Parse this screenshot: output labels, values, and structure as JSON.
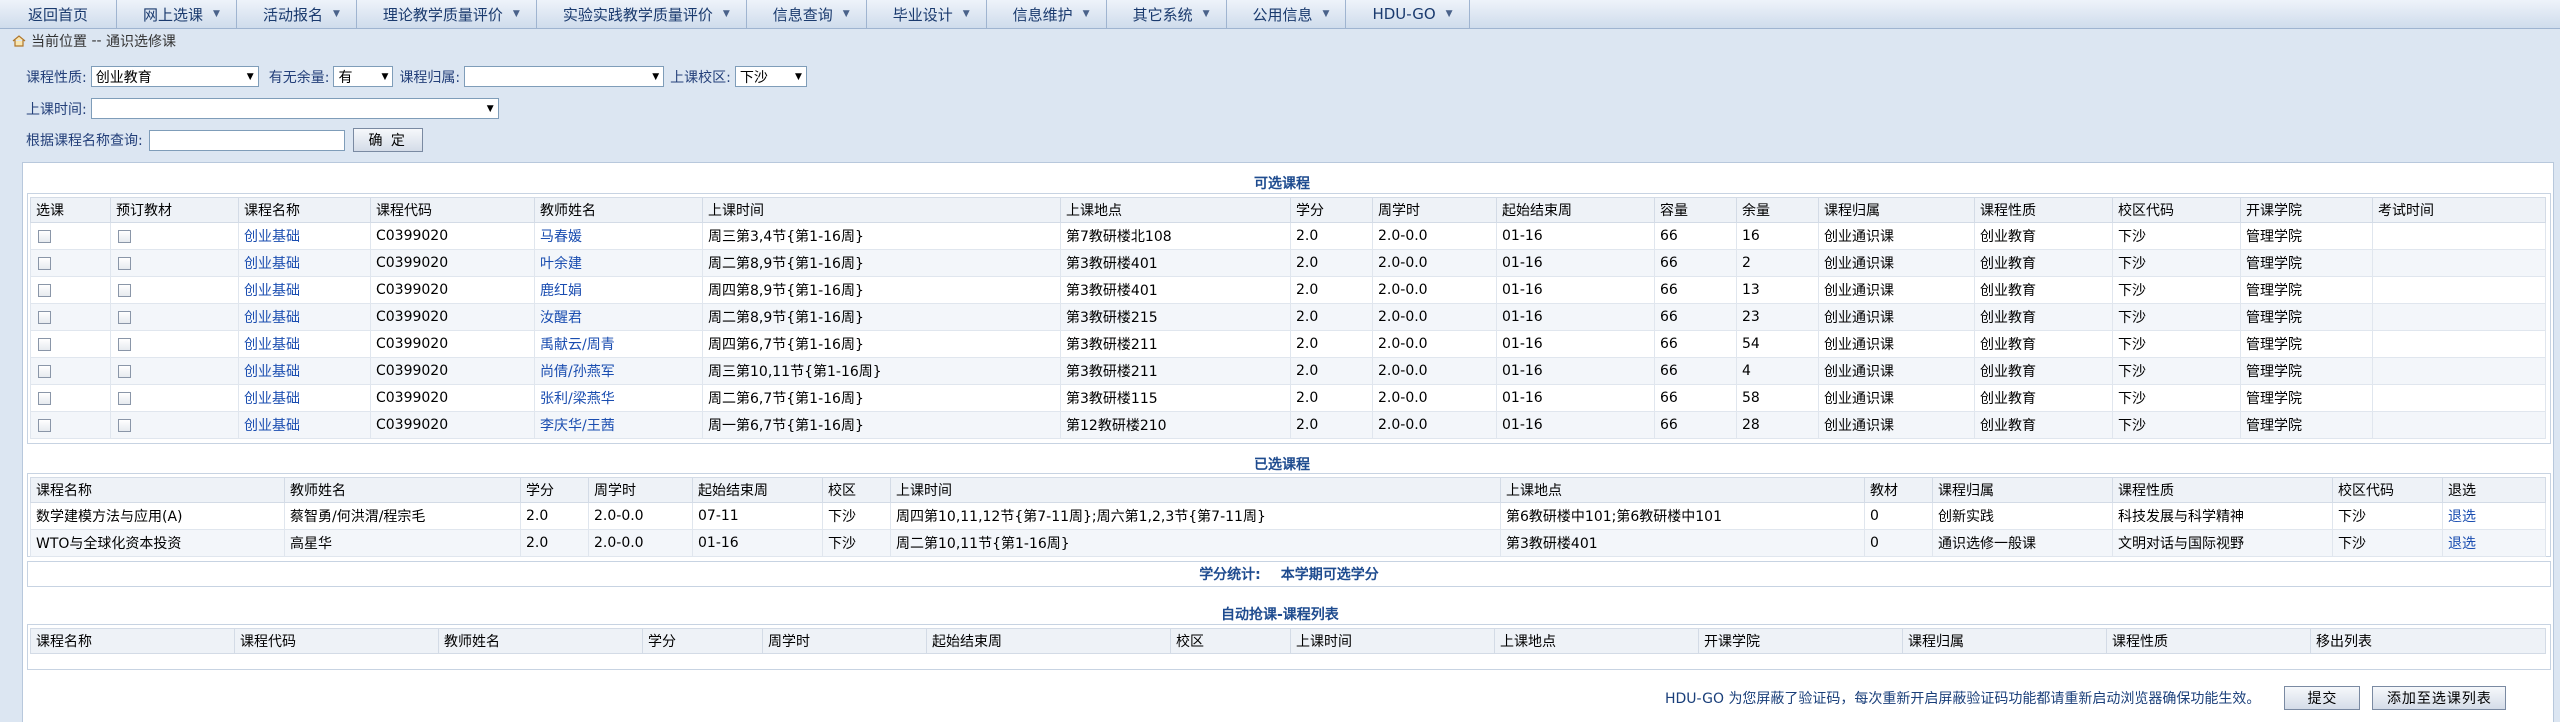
{
  "nav": [
    {
      "label": "返回首页",
      "dropdown": false
    },
    {
      "label": "网上选课",
      "dropdown": true
    },
    {
      "label": "活动报名",
      "dropdown": true
    },
    {
      "label": "理论教学质量评价",
      "dropdown": true
    },
    {
      "label": "实验实践教学质量评价",
      "dropdown": true
    },
    {
      "label": "信息查询",
      "dropdown": true
    },
    {
      "label": "毕业设计",
      "dropdown": true
    },
    {
      "label": "信息维护",
      "dropdown": true
    },
    {
      "label": "其它系统",
      "dropdown": true
    },
    {
      "label": "公用信息",
      "dropdown": true
    },
    {
      "label": "HDU-GO",
      "dropdown": true
    }
  ],
  "location": {
    "prefix": "当前位置",
    "sep": " -- ",
    "page": "通识选修课"
  },
  "filters": {
    "course_nature_label": "课程性质:",
    "course_nature_value": "创业教育",
    "remaining_label": "有无余量:",
    "remaining_value": "有",
    "category_label": "课程归属:",
    "category_value": "",
    "campus_label": "上课校区:",
    "campus_value": "下沙",
    "time_label": "上课时间:",
    "time_value": "",
    "name_query_label": "根据课程名称查询:",
    "name_query_value": "",
    "confirm_label": "确 定"
  },
  "available": {
    "title": "可选课程",
    "headers": [
      "选课",
      "预订教材",
      "课程名称",
      "课程代码",
      "教师姓名",
      "上课时间",
      "上课地点",
      "学分",
      "周学时",
      "起始结束周",
      "容量",
      "余量",
      "课程归属",
      "课程性质",
      "校区代码",
      "开课学院",
      "考试时间"
    ],
    "rows": [
      [
        "创业基础",
        "C0399020",
        "马春媛",
        "周三第3,4节{第1-16周}",
        "第7教研楼北108",
        "2.0",
        "2.0-0.0",
        "01-16",
        "66",
        "16",
        "创业通识课",
        "创业教育",
        "下沙",
        "管理学院",
        ""
      ],
      [
        "创业基础",
        "C0399020",
        "叶余建",
        "周二第8,9节{第1-16周}",
        "第3教研楼401",
        "2.0",
        "2.0-0.0",
        "01-16",
        "66",
        "2",
        "创业通识课",
        "创业教育",
        "下沙",
        "管理学院",
        ""
      ],
      [
        "创业基础",
        "C0399020",
        "鹿红娟",
        "周四第8,9节{第1-16周}",
        "第3教研楼401",
        "2.0",
        "2.0-0.0",
        "01-16",
        "66",
        "13",
        "创业通识课",
        "创业教育",
        "下沙",
        "管理学院",
        ""
      ],
      [
        "创业基础",
        "C0399020",
        "汝醒君",
        "周二第8,9节{第1-16周}",
        "第3教研楼215",
        "2.0",
        "2.0-0.0",
        "01-16",
        "66",
        "23",
        "创业通识课",
        "创业教育",
        "下沙",
        "管理学院",
        ""
      ],
      [
        "创业基础",
        "C0399020",
        "禹献云/周青",
        "周四第6,7节{第1-16周}",
        "第3教研楼211",
        "2.0",
        "2.0-0.0",
        "01-16",
        "66",
        "54",
        "创业通识课",
        "创业教育",
        "下沙",
        "管理学院",
        ""
      ],
      [
        "创业基础",
        "C0399020",
        "尚倩/孙燕军",
        "周三第10,11节{第1-16周}",
        "第3教研楼211",
        "2.0",
        "2.0-0.0",
        "01-16",
        "66",
        "4",
        "创业通识课",
        "创业教育",
        "下沙",
        "管理学院",
        ""
      ],
      [
        "创业基础",
        "C0399020",
        "张利/梁燕华",
        "周二第6,7节{第1-16周}",
        "第3教研楼115",
        "2.0",
        "2.0-0.0",
        "01-16",
        "66",
        "58",
        "创业通识课",
        "创业教育",
        "下沙",
        "管理学院",
        ""
      ],
      [
        "创业基础",
        "C0399020",
        "李庆华/王茜",
        "周一第6,7节{第1-16周}",
        "第12教研楼210",
        "2.0",
        "2.0-0.0",
        "01-16",
        "66",
        "28",
        "创业通识课",
        "创业教育",
        "下沙",
        "管理学院",
        ""
      ]
    ]
  },
  "selected": {
    "title": "已选课程",
    "headers": [
      "课程名称",
      "教师姓名",
      "学分",
      "周学时",
      "起始结束周",
      "校区",
      "上课时间",
      "上课地点",
      "教材",
      "课程归属",
      "课程性质",
      "校区代码",
      "退选"
    ],
    "rows": [
      [
        "数学建模方法与应用(A)",
        "蔡智勇/何洪渭/程宗毛",
        "2.0",
        "2.0-0.0",
        "07-11",
        "下沙",
        "周四第10,11,12节{第7-11周};周六第1,2,3节{第7-11周}",
        "第6教研楼中101;第6教研楼中101",
        "0",
        "创新实践",
        "科技发展与科学精神",
        "下沙",
        "退选"
      ],
      [
        "WTO与全球化资本投资",
        "高星华",
        "2.0",
        "2.0-0.0",
        "01-16",
        "下沙",
        "周二第10,11节{第1-16周}",
        "第3教研楼401",
        "0",
        "通识选修一般课",
        "文明对话与国际视野",
        "下沙",
        "退选"
      ]
    ]
  },
  "credit_stats": {
    "label": "学分统计:",
    "text": "本学期可选学分"
  },
  "auto_grab": {
    "title": "自动抢课-课程列表",
    "headers": [
      "课程名称",
      "课程代码",
      "教师姓名",
      "学分",
      "周学时",
      "起始结束周",
      "校区",
      "上课时间",
      "上课地点",
      "开课学院",
      "课程归属",
      "课程性质",
      "移出列表"
    ]
  },
  "footer": {
    "notice": "HDU-GO 为您屏蔽了验证码，每次重新开启屏蔽验证码功能都请重新启动浏览器确保功能生效。",
    "submit_label": "提交",
    "add_label": "添加至选课列表"
  }
}
